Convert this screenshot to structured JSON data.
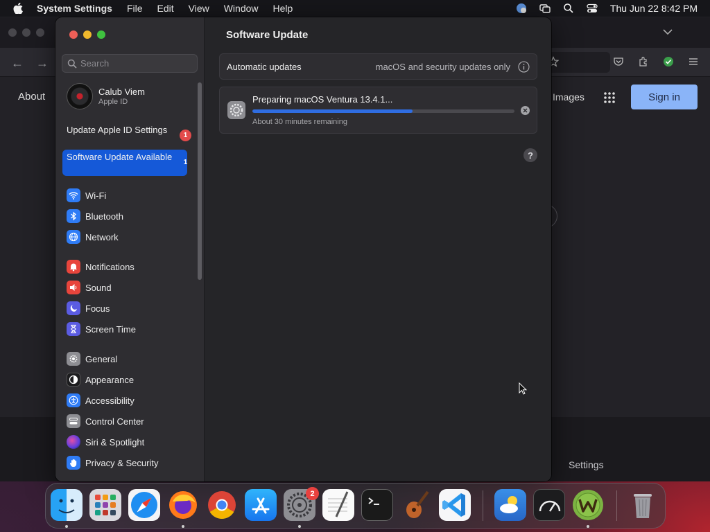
{
  "menubar": {
    "app_name": "System Settings",
    "menus": [
      "File",
      "Edit",
      "View",
      "Window",
      "Help"
    ],
    "clock": "Thu Jun 22  8:42 PM"
  },
  "browser": {
    "about_link": "About",
    "images_link": "Images",
    "signin_label": "Sign in",
    "footer_settings": "Settings"
  },
  "sidebar": {
    "search_placeholder": "Search",
    "profile": {
      "name": "Calub Viem",
      "subtitle": "Apple ID"
    },
    "notices": [
      {
        "label": "Update Apple ID Settings",
        "badge": "1"
      },
      {
        "label": "Software Update Available",
        "badge": "1"
      }
    ],
    "items": [
      {
        "label": "Wi-Fi",
        "icon": "wifi-icon",
        "color": "#2f7cf6"
      },
      {
        "label": "Bluetooth",
        "icon": "bluetooth-icon",
        "color": "#2f7cf6"
      },
      {
        "label": "Network",
        "icon": "globe-icon",
        "color": "#2f7cf6"
      },
      {
        "label": "Notifications",
        "icon": "bell-icon",
        "color": "#e8453c"
      },
      {
        "label": "Sound",
        "icon": "speaker-icon",
        "color": "#e8453c"
      },
      {
        "label": "Focus",
        "icon": "moon-icon",
        "color": "#5b5ce2"
      },
      {
        "label": "Screen Time",
        "icon": "hourglass-icon",
        "color": "#5b5ce2"
      },
      {
        "label": "General",
        "icon": "gear-icon",
        "color": "#8e8e93"
      },
      {
        "label": "Appearance",
        "icon": "appearance-icon",
        "color": "#1c1c1e"
      },
      {
        "label": "Accessibility",
        "icon": "accessibility-icon",
        "color": "#2f7cf6"
      },
      {
        "label": "Control Center",
        "icon": "control-center-icon",
        "color": "#8e8e93"
      },
      {
        "label": "Siri & Spotlight",
        "icon": "siri-icon",
        "color": "#9b3fd6"
      },
      {
        "label": "Privacy & Security",
        "icon": "hand-icon",
        "color": "#2f7cf6"
      }
    ]
  },
  "content": {
    "title": "Software Update",
    "automatic_updates": {
      "label": "Automatic updates",
      "value": "macOS and security updates only"
    },
    "update": {
      "title": "Preparing macOS Ventura 13.4.1...",
      "remaining": "About 30 minutes remaining",
      "progress": 0.61
    },
    "help_label": "?"
  },
  "dock": {
    "apps": [
      "Finder",
      "Launchpad",
      "Safari",
      "Firefox",
      "Chrome",
      "App Store",
      "System Settings",
      "TextEdit",
      "Terminal",
      "GarageBand",
      "Visual Studio Code",
      "Weather",
      "Activity Monitor",
      "W",
      "Trash"
    ],
    "settings_badge": "2"
  },
  "colors": {
    "accent": "#1559d8",
    "progress": "#2f6de2",
    "badge": "#e34b4b",
    "signin": "#8ab4f8"
  }
}
